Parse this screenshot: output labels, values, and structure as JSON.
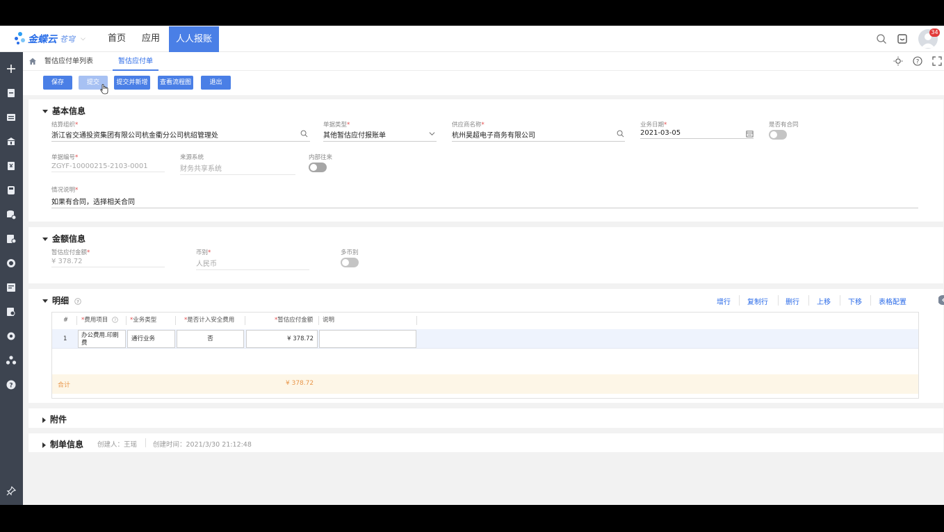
{
  "topbar": {
    "logo_text": "金蝶云",
    "logo_sub": "苍穹",
    "nav": [
      "首页",
      "应用",
      "人人报账"
    ],
    "notification_count": "34"
  },
  "breadcrumb": {
    "items": [
      "暂估应付单列表",
      "暂估应付单"
    ]
  },
  "toolbar": {
    "save": "保存",
    "submit": "提交",
    "submit_new": "提交并新增",
    "view_flow": "查看流程图",
    "exit": "退出"
  },
  "basic": {
    "title": "基本信息",
    "settle_org_label": "结算组织",
    "settle_org_value": "浙江省交通投资集团有限公司杭金衢分公司杭绍管理处",
    "doc_type_label": "单据类型",
    "doc_type_value": "其他暂估应付报账单",
    "supplier_label": "供应商名称",
    "supplier_value": "杭州昊超电子商务有限公司",
    "biz_date_label": "业务日期",
    "biz_date_value": "2021-03-05",
    "has_contract_label": "是否有合同",
    "doc_no_label": "单据编号",
    "doc_no_value": "ZGYF-10000215-2103-0001",
    "source_label": "来源系统",
    "source_value": "财务共享系统",
    "internal_label": "内部往来",
    "desc_label": "情况说明",
    "desc_value": "如果有合同，选择相关合同"
  },
  "amount": {
    "title": "金额信息",
    "amount_label": "暂估应付金额",
    "amount_value": "¥ 378.72",
    "currency_label": "币别",
    "currency_value": "人民币",
    "multi_currency_label": "多币别"
  },
  "detail": {
    "title": "明细",
    "actions": [
      "增行",
      "复制行",
      "删行",
      "上移",
      "下移",
      "表格配置"
    ],
    "columns": [
      "#",
      "费用项目",
      "业务类型",
      "是否计入安全费用",
      "暂估应付金额",
      "说明"
    ],
    "rows": [
      {
        "no": "1",
        "expense_item": "办公费用.印刷费",
        "biz_type": "通行业务",
        "safety": "否",
        "amount": "¥ 378.72",
        "note": ""
      }
    ],
    "total_label": "合计",
    "total_value": "¥ 378.72"
  },
  "attachment": {
    "title": "附件"
  },
  "creator": {
    "title": "制单信息",
    "creator_text": "创建人：王瑶",
    "created_time_text": "创建时间：2021/3/30 21:12:48"
  },
  "colors": {
    "accent": "#4a7fe6",
    "sidebar": "#3d4450",
    "link": "#2b6be8",
    "total_text": "#e8964a"
  }
}
